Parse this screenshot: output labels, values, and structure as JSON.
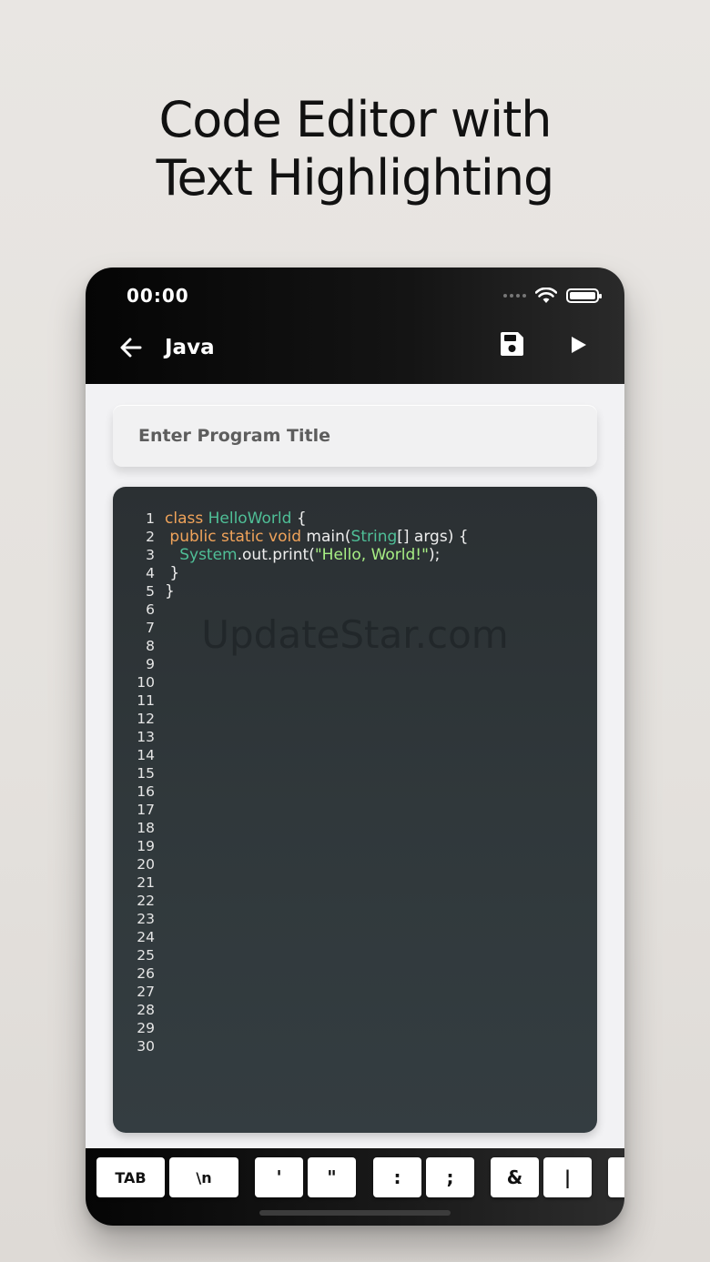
{
  "headline": {
    "line1": "Code Editor with",
    "line2": "Text Highlighting"
  },
  "status_bar": {
    "time": "00:00"
  },
  "app_bar": {
    "title": "Java"
  },
  "title_input": {
    "placeholder": "Enter Program Title",
    "value": ""
  },
  "editor": {
    "line_numbers": [
      "1",
      "2",
      "3",
      "4",
      "5",
      "6",
      "7",
      "8",
      "9",
      "10",
      "11",
      "12",
      "13",
      "14",
      "15",
      "16",
      "17",
      "18",
      "19",
      "20",
      "21",
      "22",
      "23",
      "24",
      "25",
      "26",
      "27",
      "28",
      "29",
      "30"
    ],
    "lines": [
      [
        {
          "t": "class ",
          "c": "kw"
        },
        {
          "t": "HelloWorld",
          "c": "ty"
        },
        {
          "t": " {",
          "c": ""
        }
      ],
      [
        {
          "t": " ",
          "c": ""
        },
        {
          "t": "public static void ",
          "c": "kw"
        },
        {
          "t": "main(",
          "c": ""
        },
        {
          "t": "String",
          "c": "ty"
        },
        {
          "t": "[] args) {",
          "c": ""
        }
      ],
      [
        {
          "t": "   ",
          "c": ""
        },
        {
          "t": "System",
          "c": "ty"
        },
        {
          "t": ".out.print(",
          "c": ""
        },
        {
          "t": "\"Hello, World!\"",
          "c": "str"
        },
        {
          "t": ");",
          "c": ""
        }
      ],
      [
        {
          "t": " }",
          "c": ""
        }
      ],
      [
        {
          "t": "}",
          "c": ""
        }
      ]
    ],
    "watermark": "UpdateStar.com"
  },
  "keys": [
    "TAB",
    "\\n",
    "'",
    "\"",
    ":",
    ";",
    "&",
    "|"
  ],
  "colors": {
    "keyword": "#f0a35a",
    "type": "#4fbf97",
    "string": "#a7ee84",
    "editor_bg": "#30383b"
  }
}
